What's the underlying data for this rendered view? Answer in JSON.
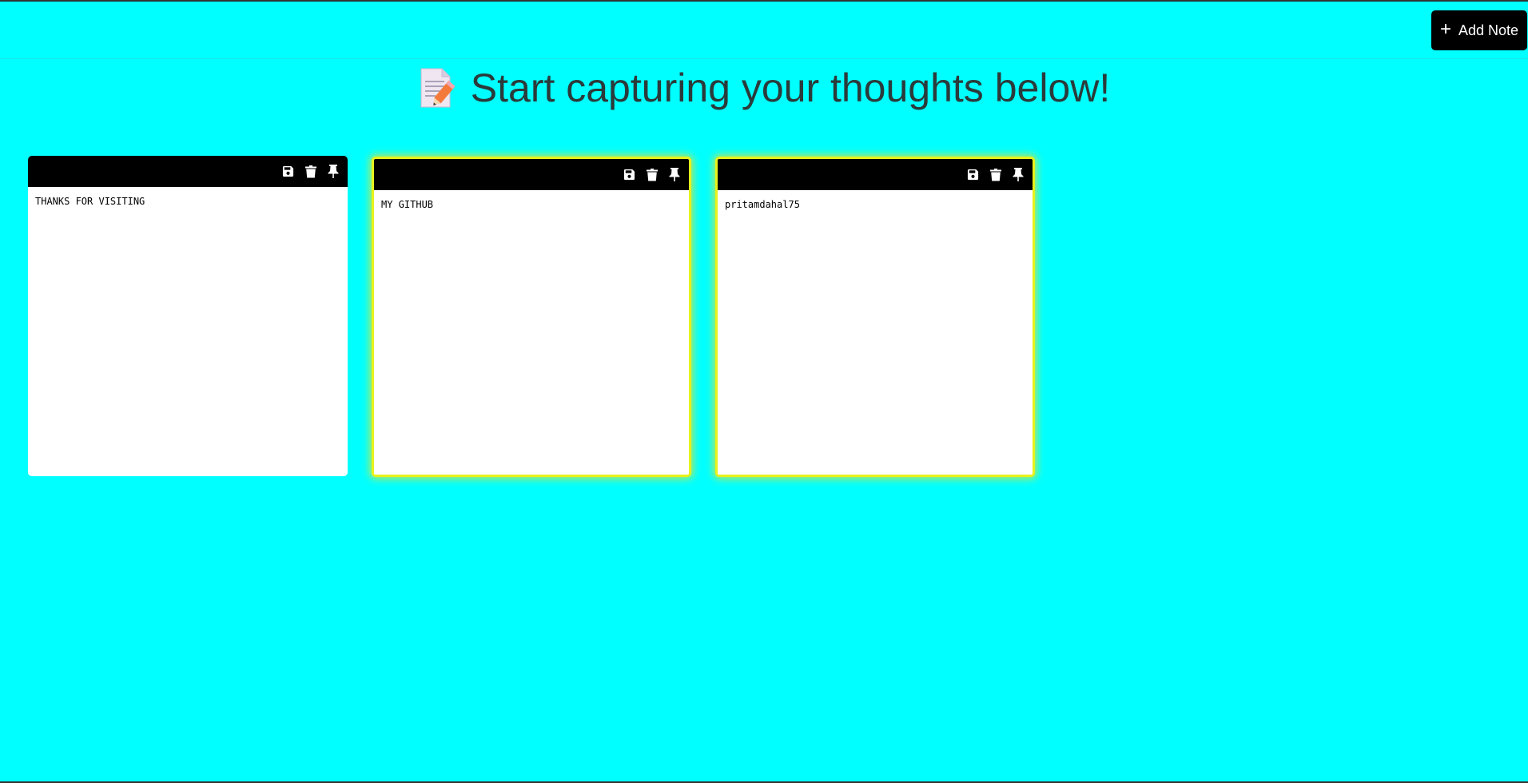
{
  "toolbar": {
    "add_note_label": "Add Note",
    "add_note_icon": "plus-icon"
  },
  "header": {
    "title": "Start capturing your thoughts below!",
    "title_icon": "memo-icon"
  },
  "notes": [
    {
      "text": "THANKS FOR VISITING",
      "highlighted": false
    },
    {
      "text": "MY GITHUB",
      "highlighted": true
    },
    {
      "text": "pritamdahal75",
      "highlighted": true
    }
  ],
  "note_actions": [
    "save-icon",
    "trash-icon",
    "pin-icon"
  ],
  "colors": {
    "background": "#00ffff",
    "note_header": "#000000",
    "note_highlight_border": "#e7f21c",
    "button_bg": "#000000",
    "button_text": "#ffffff",
    "heading_text": "#2b3a3a"
  }
}
